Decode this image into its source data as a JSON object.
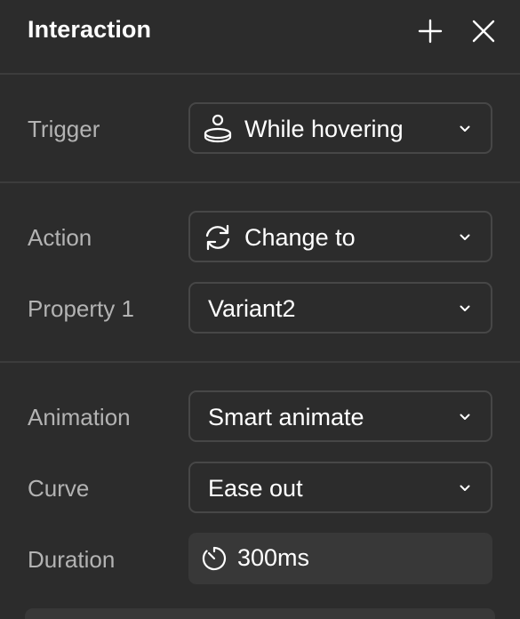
{
  "header": {
    "title": "Interaction",
    "add_icon": "plus-icon",
    "close_icon": "close-icon"
  },
  "trigger": {
    "label": "Trigger",
    "value": "While hovering",
    "icon": "hover-trigger-icon"
  },
  "action": {
    "label": "Action",
    "value": "Change to",
    "icon": "refresh-icon"
  },
  "property1": {
    "label": "Property 1",
    "value": "Variant2"
  },
  "animation": {
    "label": "Animation",
    "value": "Smart animate"
  },
  "curve": {
    "label": "Curve",
    "value": "Ease out"
  },
  "duration": {
    "label": "Duration",
    "value": "300ms",
    "icon": "timer-icon"
  },
  "colors": {
    "panel_bg": "#2c2c2c",
    "field_bg": "#383838",
    "border": "#474747",
    "label_text": "#b3b3b3",
    "value_text": "#ffffff"
  }
}
